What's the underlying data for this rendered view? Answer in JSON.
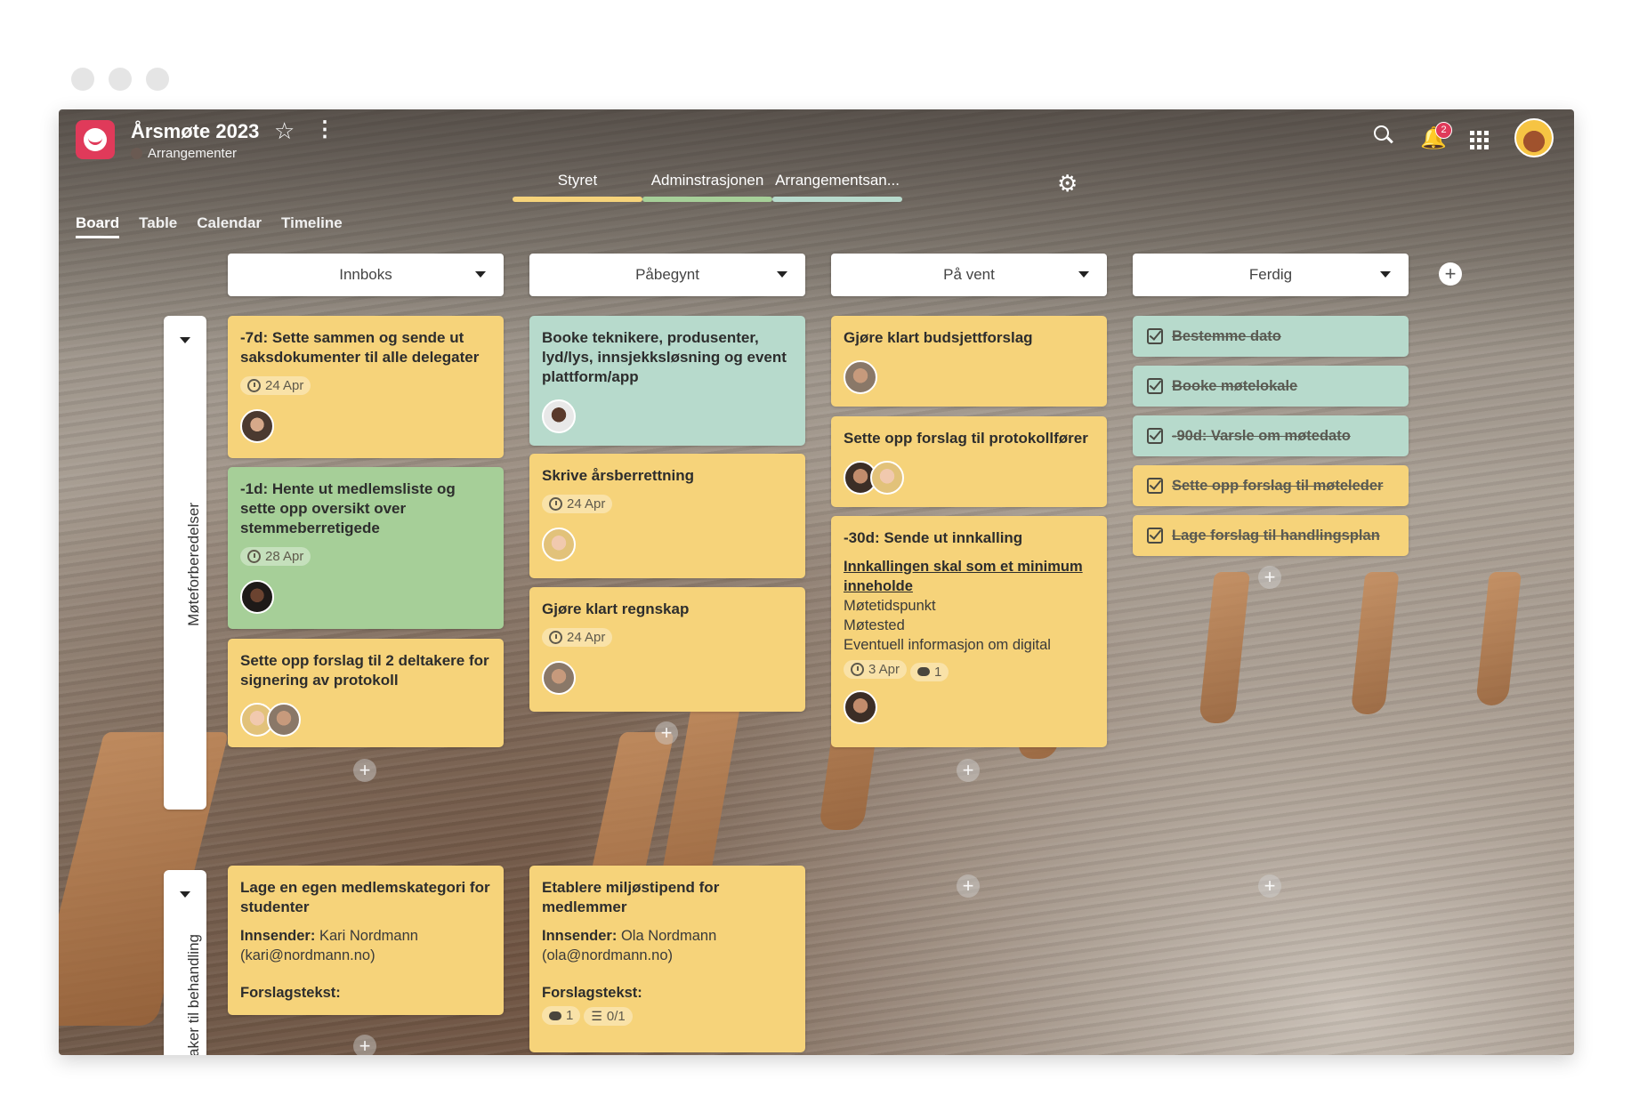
{
  "header": {
    "title": "Årsmøte 2023",
    "subtitle": "Arrangementer",
    "notifications_count": "2"
  },
  "lanes": [
    {
      "label": "Styret",
      "color": "#f6d37a"
    },
    {
      "label": "Adminstrasjonen",
      "color": "#a6cf98"
    },
    {
      "label": "Arrangementsan...",
      "color": "#b7dacc"
    }
  ],
  "view_tabs": [
    "Board",
    "Table",
    "Calendar",
    "Timeline"
  ],
  "columns": [
    "Innboks",
    "Påbegynt",
    "På vent",
    "Ferdig"
  ],
  "groups": [
    "Møteforberedelser",
    "Saker til behandling"
  ],
  "cards": {
    "c1": {
      "title": "-7d: Sette sammen og sende ut saksdokumenter til alle delegater",
      "date": "24 Apr"
    },
    "c2": {
      "title": "-1d: Hente ut medlemsliste og sette opp oversikt over stemmeberretigede",
      "date": "28 Apr"
    },
    "c3": {
      "title": "Sette opp forslag til 2 deltakere for signering av protokoll"
    },
    "c4": {
      "title": "Booke teknikere, produsenter, lyd/lys, innsjekksløsning og event plattform/app"
    },
    "c5": {
      "title": "Skrive årsberrettning",
      "date": "24 Apr"
    },
    "c6": {
      "title": "Gjøre klart regnskap",
      "date": "24 Apr"
    },
    "c7": {
      "title": "Gjøre klart budsjettforslag"
    },
    "c8": {
      "title": "Sette opp forslag til protokollfører"
    },
    "c9": {
      "title": "-30d: Sende ut innkalling",
      "link": "Innkallingen skal som et minimum inneholde",
      "lines": [
        "Møtetidspunkt",
        "Møtested",
        "Eventuell informasjon om digital"
      ],
      "date": "3 Apr",
      "comments": "1"
    },
    "c10": {
      "title": "Lage en egen medlemskategori for studenter",
      "sender_label": "Innsender:",
      "sender": "Kari Nordmann (kari@nordmann.no)",
      "text_label": "Forslagstekst:"
    },
    "c11": {
      "title": "Etablere miljøstipend for medlemmer",
      "sender_label": "Innsender:",
      "sender": "Ola Nordmann (ola@nordmann.no)",
      "text_label": "Forslagstekst:",
      "comments": "1",
      "checklist": "0/1"
    }
  },
  "done_cards": [
    {
      "title": "Bestemme dato",
      "color": "#b7dacc"
    },
    {
      "title": "Booke møtelokale",
      "color": "#b7dacc"
    },
    {
      "title": "-90d: Varsle om møtedato",
      "color": "#b7dacc"
    },
    {
      "title": "Sette opp forslag til møteleder",
      "color": "#f6d37a"
    },
    {
      "title": "Lage forslag til handlingsplan",
      "color": "#f6d37a"
    }
  ]
}
